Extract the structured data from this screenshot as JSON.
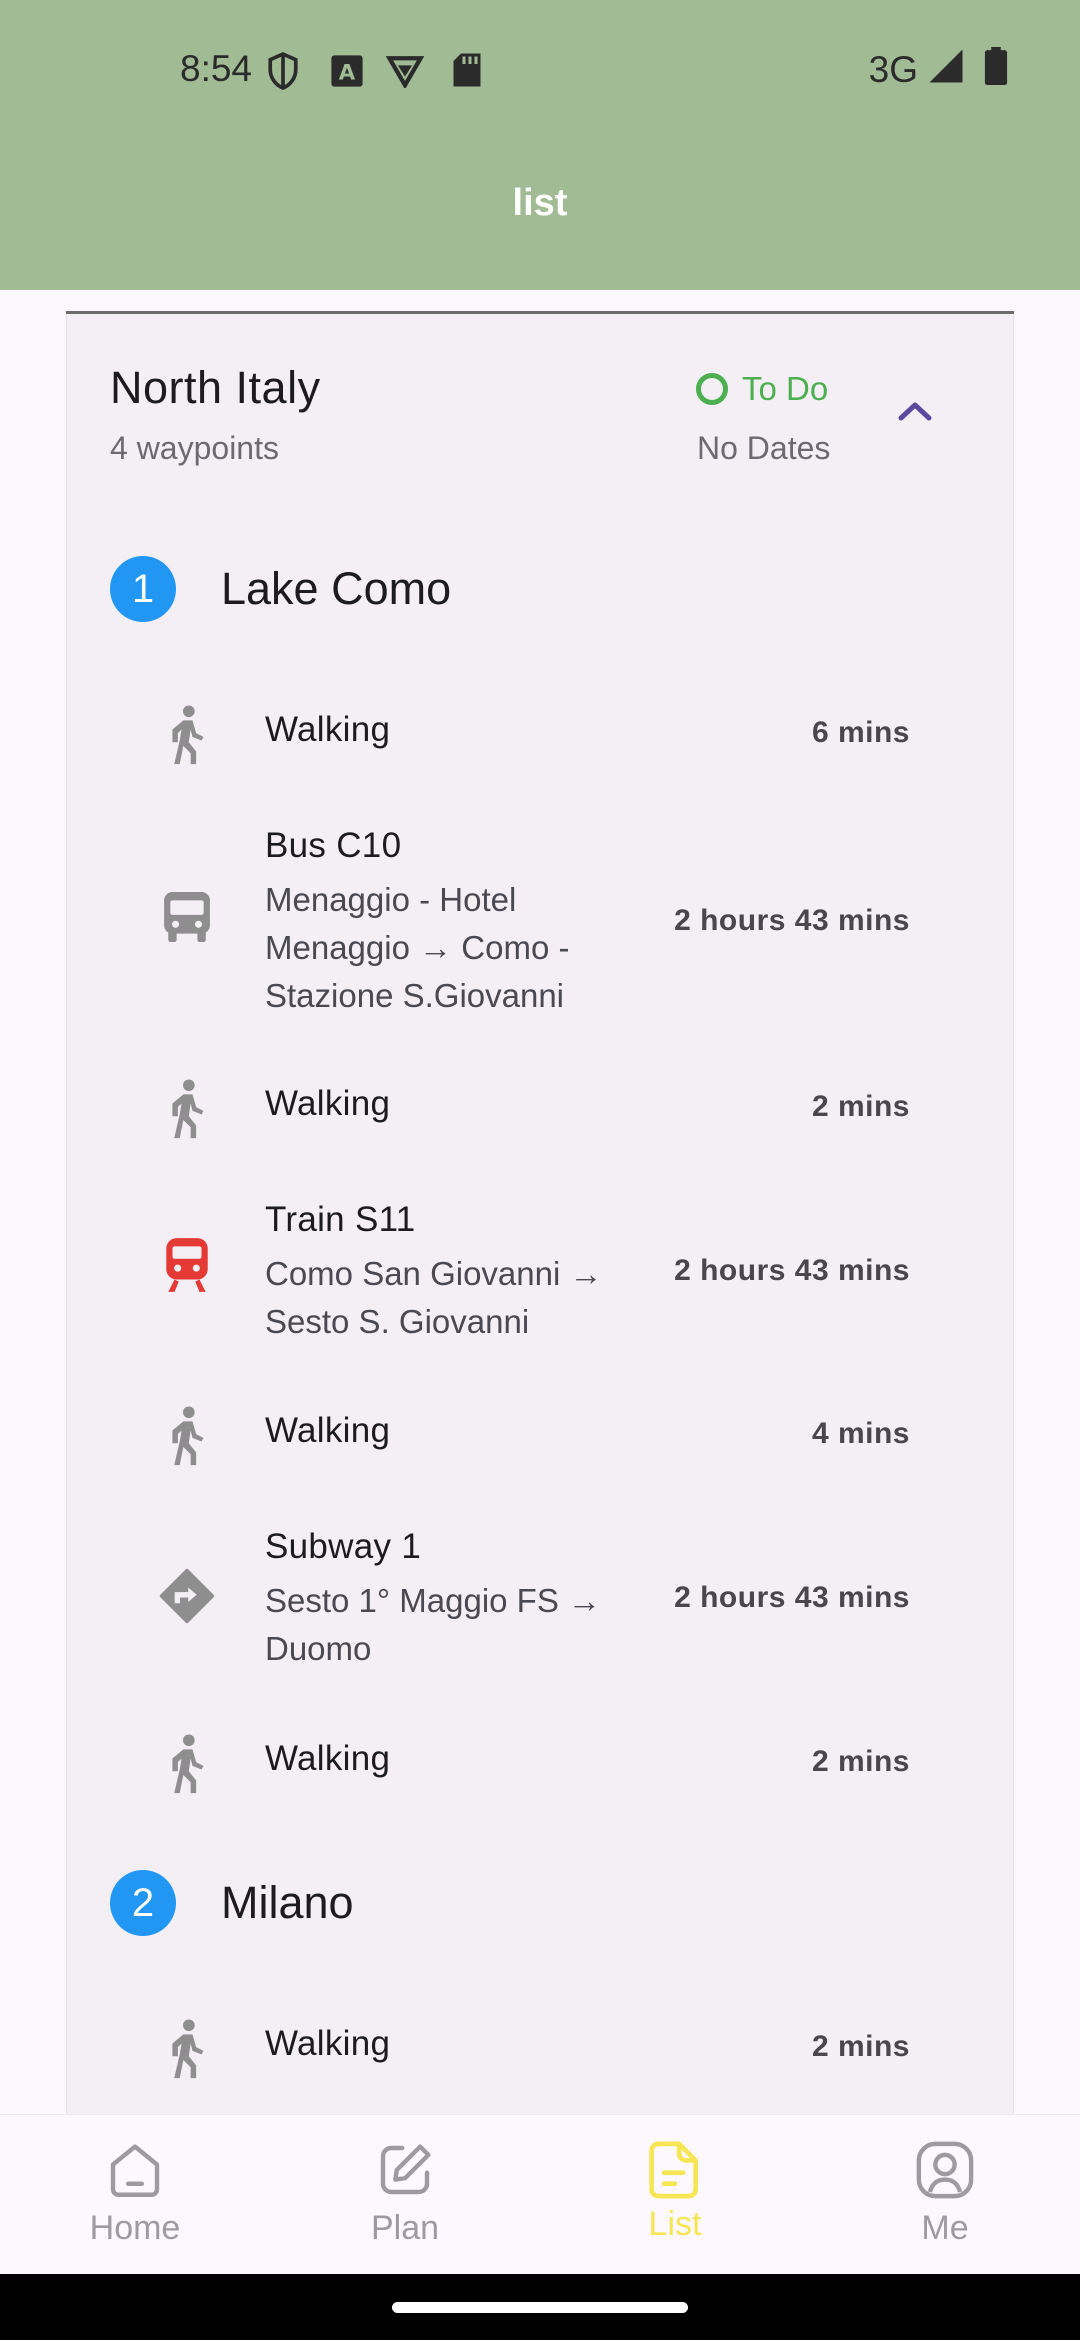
{
  "status_bar": {
    "time": "8:54",
    "network": "3G",
    "icons": [
      "shield-icon",
      "a-badge-icon",
      "vpn-icon",
      "sd-card-icon",
      "signal-icon",
      "battery-icon"
    ]
  },
  "app_bar": {
    "title": "list"
  },
  "trip": {
    "title": "North Italy",
    "subtitle": "4 waypoints",
    "status": "To Do",
    "dates": "No Dates",
    "status_color": "#4caf50"
  },
  "waypoints": [
    {
      "number": "1",
      "name": "Lake Como"
    },
    {
      "number": "2",
      "name": "Milano"
    }
  ],
  "legs": [
    {
      "icon": "walking-icon",
      "title": "Walking",
      "desc": "",
      "duration": "6 mins"
    },
    {
      "icon": "bus-icon",
      "title": "Bus C10",
      "desc": "Menaggio - Hotel Menaggio → Como - Stazione S.Giovanni",
      "duration": "2 hours 43 mins"
    },
    {
      "icon": "walking-icon",
      "title": "Walking",
      "desc": "",
      "duration": "2 mins"
    },
    {
      "icon": "train-icon",
      "title": "Train S11",
      "desc": "Como San Giovanni → Sesto S. Giovanni",
      "duration": "2 hours 43 mins"
    },
    {
      "icon": "walking-icon",
      "title": "Walking",
      "desc": "",
      "duration": "4 mins"
    },
    {
      "icon": "directions-icon",
      "title": "Subway 1",
      "desc": "Sesto 1° Maggio FS → Duomo",
      "duration": "2 hours 43 mins"
    },
    {
      "icon": "walking-icon",
      "title": "Walking",
      "desc": "",
      "duration": "2 mins"
    },
    {
      "icon": "walking-icon",
      "title": "Walking",
      "desc": "",
      "duration": "2 mins"
    }
  ],
  "bottom_nav": {
    "items": [
      {
        "label": "Home",
        "icon": "home-icon"
      },
      {
        "label": "Plan",
        "icon": "edit-icon"
      },
      {
        "label": "List",
        "icon": "list-icon",
        "active": true
      },
      {
        "label": "Me",
        "icon": "profile-icon"
      }
    ],
    "active_color": "#f6e653"
  },
  "colors": {
    "header": "#a1bb95",
    "waypoint_badge": "#2196f3",
    "train_icon": "#e53935",
    "transit_icon": "#8e8e8e"
  }
}
